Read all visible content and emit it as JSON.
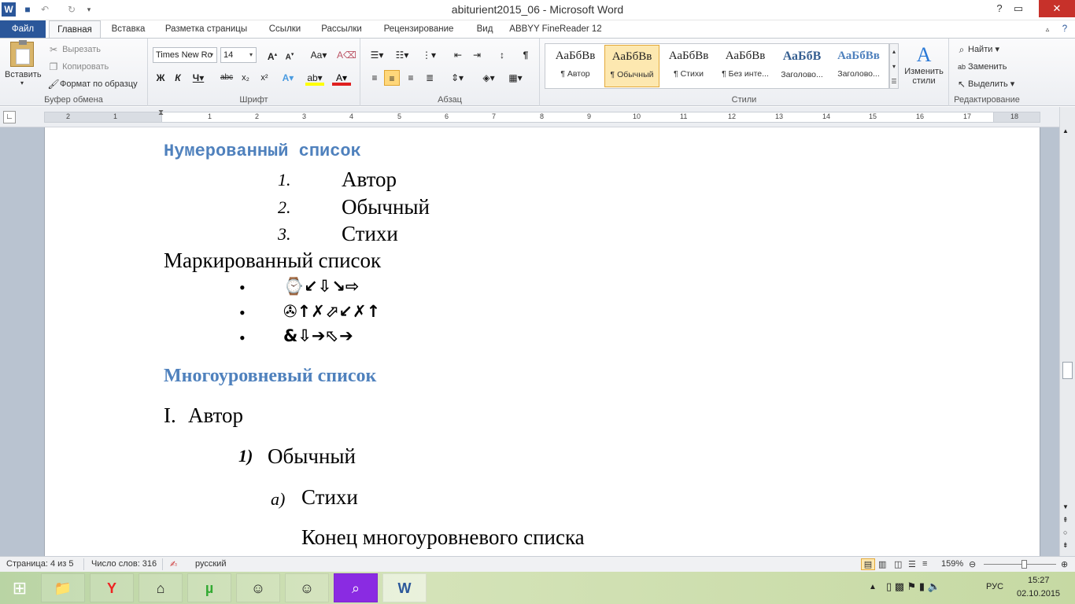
{
  "window": {
    "title": "abiturient2015_06 - Microsoft Word"
  },
  "tabs": [
    "Файл",
    "Главная",
    "Вставка",
    "Разметка страницы",
    "Ссылки",
    "Рассылки",
    "Рецензирование",
    "Вид",
    "ABBYY FineReader 12"
  ],
  "clipboard": {
    "paste": "Вставить",
    "cut": "Вырезать",
    "copy": "Копировать",
    "format_painter": "Формат по образцу",
    "label": "Буфер обмена"
  },
  "font": {
    "name": "Times New Ro",
    "size": "14",
    "label": "Шрифт"
  },
  "paragraph": {
    "label": "Абзац"
  },
  "styles": {
    "label": "Стили",
    "items": [
      {
        "preview": "АаБбВв",
        "name": "¶ Автор"
      },
      {
        "preview": "АаБбВв",
        "name": "¶ Обычный"
      },
      {
        "preview": "АаБбВв",
        "name": "¶ Стихи"
      },
      {
        "preview": "АаБбВв",
        "name": "¶ Без инте..."
      },
      {
        "preview": "АаБбВ",
        "name": "Заголово..."
      },
      {
        "preview": "АаБбВв",
        "name": "Заголово..."
      }
    ],
    "change_styles": "Изменить стили"
  },
  "editing": {
    "find": "Найти",
    "replace": "Заменить",
    "select": "Выделить",
    "label": "Редактирование"
  },
  "ruler": {
    "numbers": [
      "2",
      "1",
      "1",
      "2",
      "3",
      "4",
      "5",
      "6",
      "7",
      "8",
      "9",
      "10",
      "11",
      "12",
      "13",
      "14",
      "15",
      "16",
      "17",
      "18"
    ]
  },
  "document": {
    "h_numbered": "Нумерованный список",
    "numbered": [
      {
        "n": "1.",
        "t": "Автор"
      },
      {
        "n": "2.",
        "t": "Обычный"
      },
      {
        "n": "3.",
        "t": "Стихи"
      }
    ],
    "h_bulleted": "Маркированный список",
    "bullets": [
      "⌚↙⇩↘⇨",
      "✇↑✗⬀↙✗↑",
      "&⇩➔⬁➔"
    ],
    "h_multilevel": "Многоуровневый список",
    "l1": {
      "n": "I.",
      "t": "Автор"
    },
    "l2": {
      "n": "1)",
      "t": "Обычный"
    },
    "l3": {
      "n": "а)",
      "t": "Стихи"
    },
    "end": "Конец многоуровневого списка"
  },
  "status": {
    "page": "Страница: 4 из 5",
    "words": "Число слов: 316",
    "lang": "русский",
    "zoom": "159%"
  },
  "tray": {
    "lang": "РУС",
    "time": "15:27",
    "date": "02.10.2015"
  }
}
